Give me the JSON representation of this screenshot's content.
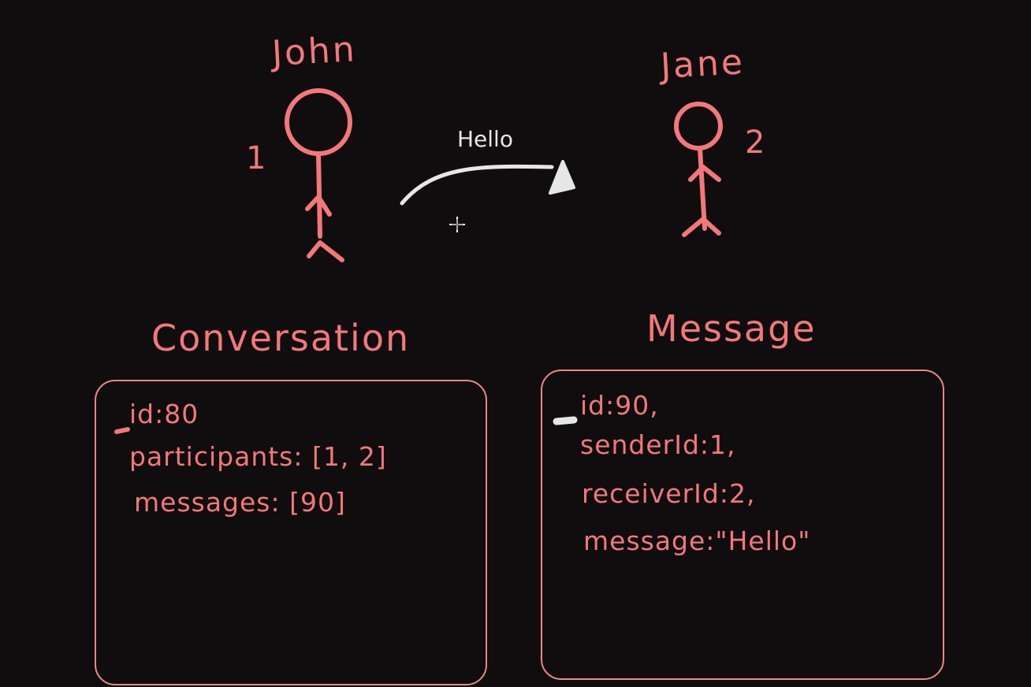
{
  "actors": {
    "john": {
      "name": "John",
      "id_label": "1"
    },
    "jane": {
      "name": "Jane",
      "id_label": "2"
    }
  },
  "arrow_label": "Hello",
  "conversation": {
    "title": "Conversation",
    "fields": [
      "id:80",
      "participants: [1, 2]",
      "messages: [90]"
    ]
  },
  "message": {
    "title": "Message",
    "fields": [
      "id:90,",
      "senderId:1,",
      "receiverId:2,",
      "message:\"Hello\""
    ]
  },
  "colors": {
    "ink": "#f4777a",
    "arrow": "#e6e6e6",
    "background": "#0f0d0d"
  }
}
